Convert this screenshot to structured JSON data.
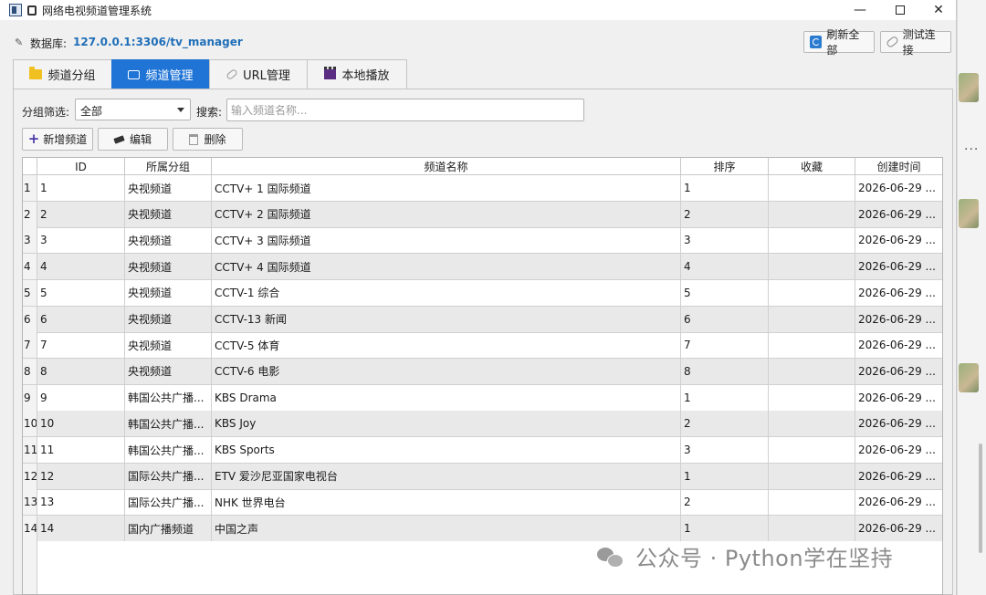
{
  "window": {
    "title": "网络电视频道管理系统"
  },
  "database": {
    "label": "数据库:",
    "value": "127.0.0.1:3306/tv_manager"
  },
  "toolbar": {
    "refresh_label": "刷新全部",
    "test_label": "测试连接"
  },
  "tabs": [
    {
      "label": "频道分组",
      "icon": "folder-icon",
      "active": false
    },
    {
      "label": "频道管理",
      "icon": "tv-icon",
      "active": true
    },
    {
      "label": "URL管理",
      "icon": "link-icon",
      "active": false
    },
    {
      "label": "本地播放",
      "icon": "clapper-icon",
      "active": false
    }
  ],
  "filter": {
    "group_label": "分组筛选:",
    "group_value": "全部",
    "search_label": "搜索:",
    "search_placeholder": "输入频道名称..."
  },
  "actions": {
    "add_label": "新增频道",
    "edit_label": "编辑",
    "delete_label": "删除"
  },
  "table": {
    "headers": [
      "ID",
      "所属分组",
      "频道名称",
      "排序",
      "收藏",
      "创建时间"
    ],
    "rows": [
      {
        "num": "1",
        "id": "1",
        "group": "央视频道",
        "name": "CCTV+ 1 国际频道",
        "sort": "1",
        "fav": "",
        "time": "2026-06-29 ..."
      },
      {
        "num": "2",
        "id": "2",
        "group": "央视频道",
        "name": "CCTV+ 2 国际频道",
        "sort": "2",
        "fav": "",
        "time": "2026-06-29 ..."
      },
      {
        "num": "3",
        "id": "3",
        "group": "央视频道",
        "name": "CCTV+ 3 国际频道",
        "sort": "3",
        "fav": "",
        "time": "2026-06-29 ..."
      },
      {
        "num": "4",
        "id": "4",
        "group": "央视频道",
        "name": "CCTV+ 4 国际频道",
        "sort": "4",
        "fav": "",
        "time": "2026-06-29 ..."
      },
      {
        "num": "5",
        "id": "5",
        "group": "央视频道",
        "name": "CCTV-1 综合",
        "sort": "5",
        "fav": "",
        "time": "2026-06-29 ..."
      },
      {
        "num": "6",
        "id": "6",
        "group": "央视频道",
        "name": "CCTV-13 新闻",
        "sort": "6",
        "fav": "",
        "time": "2026-06-29 ..."
      },
      {
        "num": "7",
        "id": "7",
        "group": "央视频道",
        "name": "CCTV-5 体育",
        "sort": "7",
        "fav": "",
        "time": "2026-06-29 ..."
      },
      {
        "num": "8",
        "id": "8",
        "group": "央视频道",
        "name": "CCTV-6 电影",
        "sort": "8",
        "fav": "",
        "time": "2026-06-29 ..."
      },
      {
        "num": "9",
        "id": "9",
        "group": "韩国公共广播...",
        "name": "KBS Drama",
        "sort": "1",
        "fav": "",
        "time": "2026-06-29 ..."
      },
      {
        "num": "10",
        "id": "10",
        "group": "韩国公共广播...",
        "name": "KBS Joy",
        "sort": "2",
        "fav": "",
        "time": "2026-06-29 ..."
      },
      {
        "num": "11",
        "id": "11",
        "group": "韩国公共广播...",
        "name": "KBS Sports",
        "sort": "3",
        "fav": "",
        "time": "2026-06-29 ..."
      },
      {
        "num": "12",
        "id": "12",
        "group": "国际公共广播...",
        "name": "ETV 爱沙尼亚国家电视台",
        "sort": "1",
        "fav": "",
        "time": "2026-06-29 ..."
      },
      {
        "num": "13",
        "id": "13",
        "group": "国际公共广播...",
        "name": "NHK 世界电台",
        "sort": "2",
        "fav": "",
        "time": "2026-06-29 ..."
      },
      {
        "num": "14",
        "id": "14",
        "group": "国内广播频道",
        "name": "中国之声",
        "sort": "1",
        "fav": "",
        "time": "2026-06-29 ..."
      }
    ]
  },
  "watermark": {
    "text": "公众号 · Python学在坚持"
  },
  "colors": {
    "accent": "#1f74d6",
    "db_value": "#1f6fb8"
  }
}
